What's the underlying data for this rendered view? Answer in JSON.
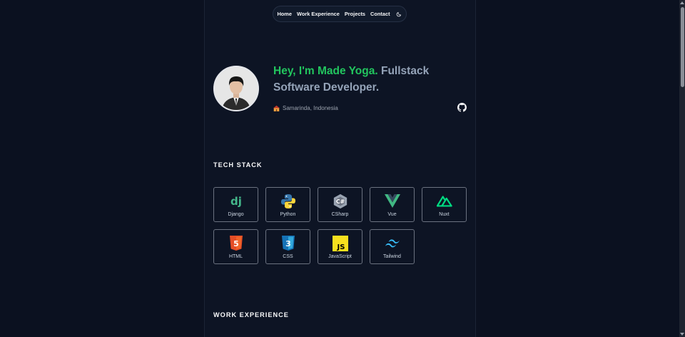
{
  "nav": {
    "items": [
      "Home",
      "Work Experience",
      "Projects",
      "Contact"
    ],
    "theme_toggle_icon": "moon-icon"
  },
  "hero": {
    "greeting": "Hey, I'm Made Yoga.",
    "role": " Fullstack Software Developer.",
    "location_icon": "house-emoji",
    "location": "Samarinda, Indonesia",
    "github_icon": "github-icon",
    "avatar_icon": "profile-photo"
  },
  "tech_stack": {
    "title": "TECH STACK",
    "items": [
      {
        "label": "Django",
        "icon": "django-icon"
      },
      {
        "label": "Python",
        "icon": "python-icon"
      },
      {
        "label": "CSharp",
        "icon": "csharp-icon"
      },
      {
        "label": "Vue",
        "icon": "vue-icon"
      },
      {
        "label": "Nuxt",
        "icon": "nuxt-icon"
      },
      {
        "label": "HTML",
        "icon": "html5-icon"
      },
      {
        "label": "CSS",
        "icon": "css3-icon"
      },
      {
        "label": "JavaScript",
        "icon": "javascript-icon"
      },
      {
        "label": "Tailwind",
        "icon": "tailwind-icon"
      }
    ]
  },
  "work": {
    "title": "WORK EXPERIENCE"
  },
  "colors": {
    "background": "#0b1120",
    "accent_green": "#22c55e",
    "muted_text": "#94a3b8"
  }
}
